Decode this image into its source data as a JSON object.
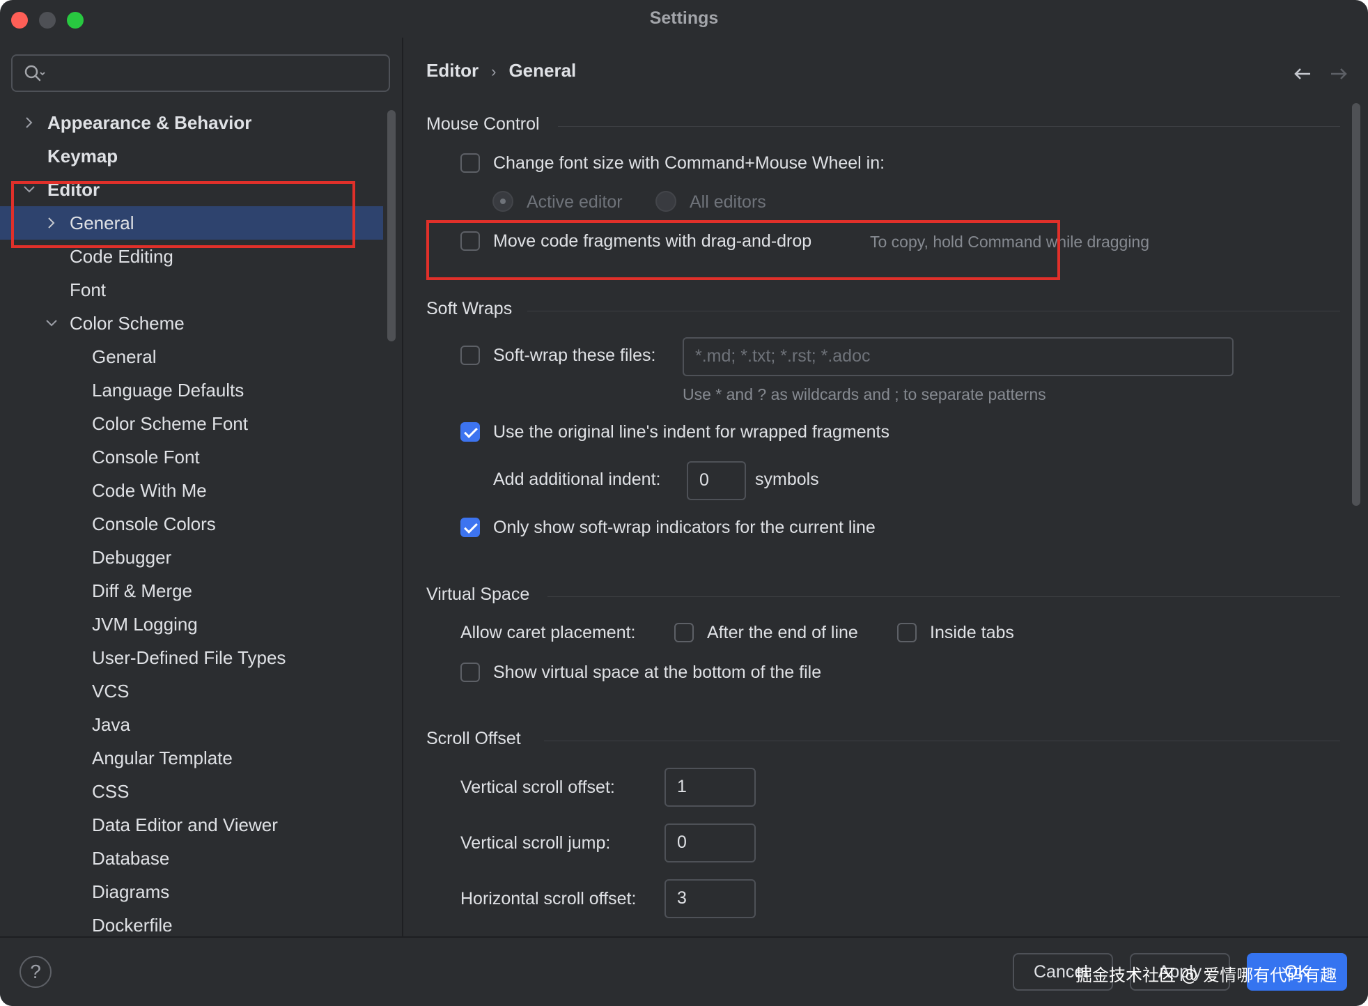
{
  "window": {
    "title": "Settings"
  },
  "sidebar": {
    "search": {
      "value": "",
      "placeholder": ""
    },
    "items": [
      {
        "label": "Appearance & Behavior",
        "expanded": false
      },
      {
        "label": "Keymap"
      },
      {
        "label": "Editor",
        "expanded": true
      },
      {
        "label": "General",
        "selected": true,
        "expanded": false
      },
      {
        "label": "Code Editing"
      },
      {
        "label": "Font"
      },
      {
        "label": "Color Scheme",
        "expanded": true
      },
      {
        "label": "General"
      },
      {
        "label": "Language Defaults"
      },
      {
        "label": "Color Scheme Font"
      },
      {
        "label": "Console Font"
      },
      {
        "label": "Code With Me"
      },
      {
        "label": "Console Colors"
      },
      {
        "label": "Debugger"
      },
      {
        "label": "Diff & Merge"
      },
      {
        "label": "JVM Logging"
      },
      {
        "label": "User-Defined File Types"
      },
      {
        "label": "VCS"
      },
      {
        "label": "Java"
      },
      {
        "label": "Angular Template"
      },
      {
        "label": "CSS"
      },
      {
        "label": "Data Editor and Viewer"
      },
      {
        "label": "Database"
      },
      {
        "label": "Diagrams"
      },
      {
        "label": "Dockerfile"
      }
    ]
  },
  "breadcrumb": {
    "parent": "Editor",
    "separator": "›",
    "current": "General"
  },
  "mouse_control": {
    "title": "Mouse Control",
    "change_font_size": {
      "label": "Change font size with Command+Mouse Wheel in:",
      "checked": false
    },
    "active_editor": {
      "label": "Active editor",
      "selected": true,
      "enabled": false
    },
    "all_editors": {
      "label": "All editors",
      "selected": false,
      "enabled": false
    },
    "move_fragments": {
      "label": "Move code fragments with drag-and-drop",
      "checked": false,
      "hint": "To copy, hold Command while dragging"
    }
  },
  "soft_wraps": {
    "title": "Soft Wraps",
    "soft_wrap_files": {
      "label": "Soft-wrap these files:",
      "checked": false,
      "value": "",
      "placeholder": "*.md; *.txt; *.rst; *.adoc"
    },
    "wildcard_hint": "Use * and ? as wildcards and ; to separate patterns",
    "original_indent": {
      "label": "Use the original line's indent for wrapped fragments",
      "checked": true
    },
    "additional_indent": {
      "label": "Add additional indent:",
      "value": "0",
      "unit": "symbols"
    },
    "indicators_current_line": {
      "label": "Only show soft-wrap indicators for the current line",
      "checked": true
    }
  },
  "virtual_space": {
    "title": "Virtual Space",
    "caret_label": "Allow caret placement:",
    "after_end_of_line": {
      "label": "After the end of line",
      "checked": false
    },
    "inside_tabs": {
      "label": "Inside tabs",
      "checked": false
    },
    "show_bottom": {
      "label": "Show virtual space at the bottom of the file",
      "checked": false
    }
  },
  "scroll_offset": {
    "title": "Scroll Offset",
    "vertical_offset": {
      "label": "Vertical scroll offset:",
      "value": "1"
    },
    "vertical_jump": {
      "label": "Vertical scroll jump:",
      "value": "0"
    },
    "horizontal_offset": {
      "label": "Horizontal scroll offset:",
      "value": "3"
    }
  },
  "footer": {
    "help": "?",
    "cancel": "Cancel",
    "apply": "Apply",
    "ok": "OK",
    "watermark": "掘金技术社区 @ 爱情哪有代码有趣"
  },
  "colors": {
    "background": "#2b2d30",
    "selection": "#2e436e",
    "accent": "#3574f0",
    "annotation_red": "#e0302a"
  },
  "icons": {
    "search": "search-icon",
    "back": "arrow-left-icon",
    "forward": "arrow-right-icon",
    "expand": "chevron-right-icon",
    "collapse": "chevron-down-icon"
  }
}
